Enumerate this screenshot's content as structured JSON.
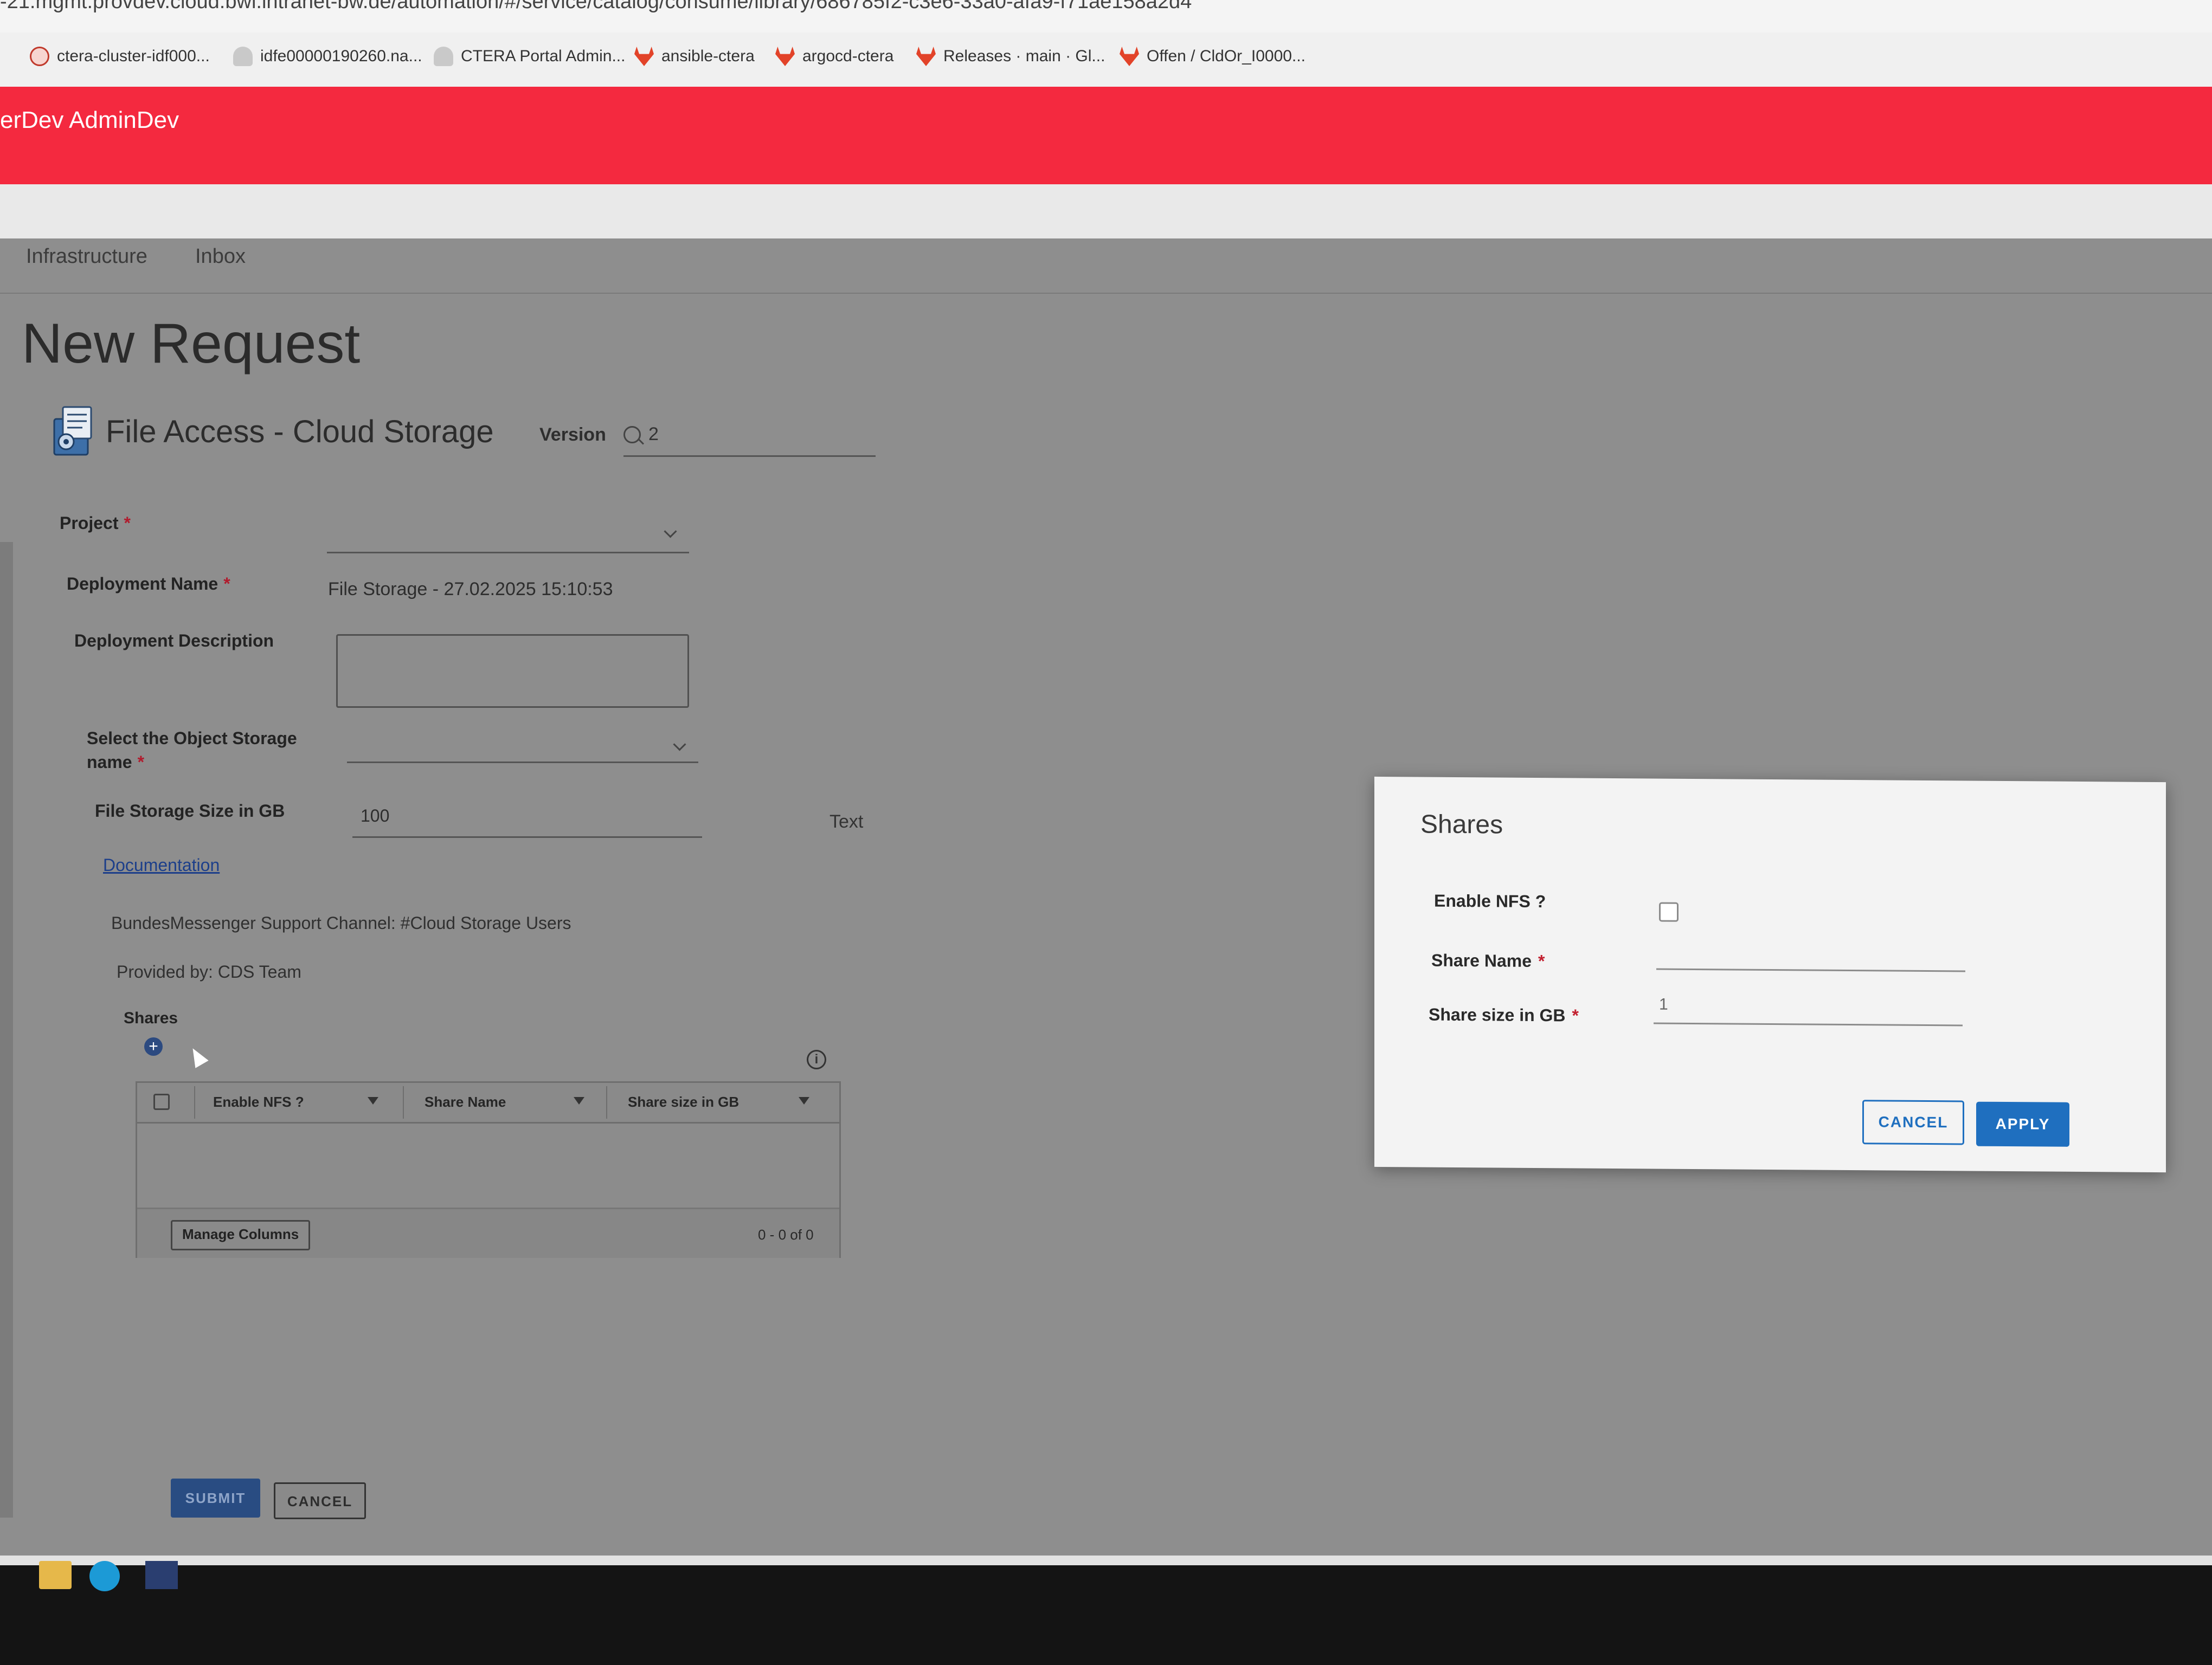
{
  "browser": {
    "url": "-21.mgmt.provdev.cloud.bwi.intranet-bw.de/automation/#/service/catalog/consume/library/686785f2-c3e6-33a0-afa9-f71ae158a2d4",
    "bookmarks": [
      {
        "label": "ctera-cluster-idf000...",
        "icon": "ctera-icon"
      },
      {
        "label": "idfe00000190260.na...",
        "icon": "cloud-icon"
      },
      {
        "label": "CTERA Portal Admin...",
        "icon": "cloud-icon"
      },
      {
        "label": "ansible-ctera",
        "icon": "gitlab-icon"
      },
      {
        "label": "argocd-ctera",
        "icon": "gitlab-icon"
      },
      {
        "label": "Releases · main · Gl...",
        "icon": "gitlab-icon"
      },
      {
        "label": "Offen / CldOr_I0000...",
        "icon": "gitlab-icon"
      }
    ]
  },
  "header": {
    "title": "erDev AdminDev",
    "brand_color": "#f4293f"
  },
  "nav": {
    "tabs": [
      "Infrastructure",
      "Inbox"
    ]
  },
  "page": {
    "title": "New Request",
    "form_title": "File Access - Cloud Storage",
    "version_label": "Version",
    "version_value": "2"
  },
  "form": {
    "project_label": "Project",
    "deployment_name_label": "Deployment Name",
    "deployment_name_value": "File Storage - 27.02.2025 15:10:53",
    "deployment_description_label": "Deployment Description",
    "object_storage_label_line1": "Select the Object Storage",
    "object_storage_label_line2": "name",
    "file_storage_size_label": "File Storage Size in GB",
    "file_storage_size_value": "100",
    "text_label": "Text",
    "documentation_link": "Documentation",
    "support_channel": "BundesMessenger Support Channel: #Cloud Storage Users",
    "provided_by": "Provided by: CDS Team",
    "shares_label": "Shares",
    "required_marker": "*"
  },
  "shares_grid": {
    "columns": [
      "Enable NFS ?",
      "Share Name",
      "Share size in GB"
    ],
    "manage_columns": "Manage Columns",
    "pagination": "0 - 0 of 0"
  },
  "actions": {
    "submit": "SUBMIT",
    "cancel": "CANCEL"
  },
  "dialog": {
    "title": "Shares",
    "enable_nfs_label": "Enable NFS ?",
    "enable_nfs_checked": false,
    "share_name_label": "Share Name",
    "share_size_label": "Share size in GB",
    "share_size_value": "1",
    "cancel": "CANCEL",
    "apply": "APPLY",
    "accent_color": "#1f6fbf"
  },
  "taskbar": {
    "icons": [
      "file-explorer-icon",
      "edge-browser-icon",
      "app-icon"
    ]
  }
}
